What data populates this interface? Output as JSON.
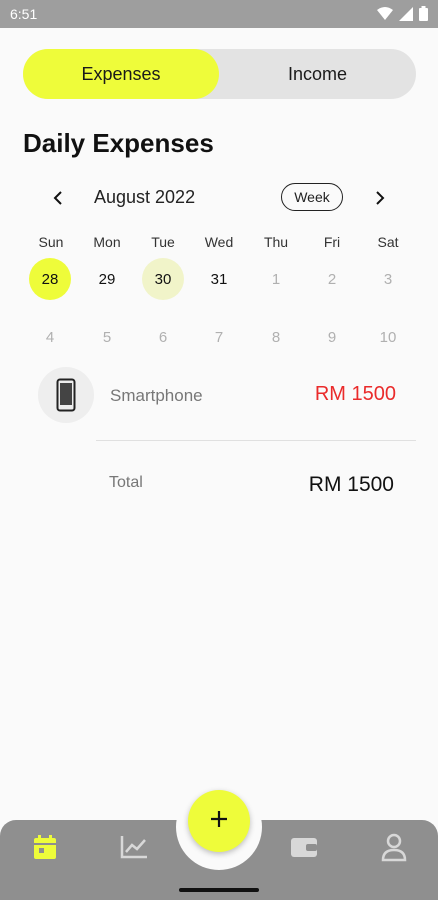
{
  "status_bar": {
    "time": "6:51"
  },
  "tabs": {
    "expenses": "Expenses",
    "income": "Income"
  },
  "title": "Daily Expenses",
  "calendar": {
    "month": "August 2022",
    "view_button": "Week",
    "weekdays": [
      "Sun",
      "Mon",
      "Tue",
      "Wed",
      "Thu",
      "Fri",
      "Sat"
    ],
    "week1": [
      "28",
      "29",
      "30",
      "31",
      "1",
      "2",
      "3"
    ],
    "week2": [
      "4",
      "5",
      "6",
      "7",
      "8",
      "9",
      "10"
    ]
  },
  "expense_item": {
    "icon": "smartphone-icon",
    "name": "Smartphone",
    "amount": "RM 1500"
  },
  "total": {
    "label": "Total",
    "value": "RM 1500"
  },
  "bottom_nav": {
    "items": [
      "calendar-icon",
      "chart-icon",
      "wallet-icon",
      "profile-icon"
    ],
    "fab_icon": "plus-icon"
  },
  "colors": {
    "accent": "#eefc3a",
    "accent_light": "#f1f4c9",
    "amount_red": "#ea2b2b",
    "nav_bg": "#8f8f8f"
  }
}
